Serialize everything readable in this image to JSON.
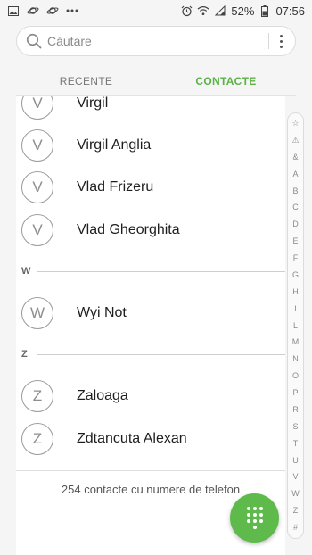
{
  "status_bar": {
    "battery": "52%",
    "time": "07:56",
    "left_icons": [
      "gallery-icon",
      "saturn-icon",
      "saturn-icon",
      "more-dots-icon"
    ],
    "right_icons": [
      "alarm-icon",
      "wifi-icon",
      "signal-icon",
      "battery-icon"
    ]
  },
  "search": {
    "placeholder": "Căutare",
    "icon": "search-icon",
    "menu_icon": "more-vertical-icon"
  },
  "tabs": [
    {
      "label": "RECENTE",
      "active": false
    },
    {
      "label": "CONTACTE",
      "active": true
    }
  ],
  "colors": {
    "accent": "#5cb247",
    "fab": "#5fba4c"
  },
  "contacts": {
    "groups": [
      {
        "letter": "",
        "items": [
          {
            "initial": "V",
            "name": "Virgil"
          },
          {
            "initial": "V",
            "name": "Virgil Anglia"
          },
          {
            "initial": "V",
            "name": "Vlad Frizeru"
          },
          {
            "initial": "V",
            "name": "Vlad Gheorghita"
          }
        ]
      },
      {
        "letter": "W",
        "items": [
          {
            "initial": "W",
            "name": "Wyi Not"
          }
        ]
      },
      {
        "letter": "Z",
        "items": [
          {
            "initial": "Z",
            "name": "Zaloaga"
          },
          {
            "initial": "Z",
            "name": "Zdtancuta Alexan"
          }
        ]
      }
    ],
    "count_text": "254 contacte cu numere de telefon"
  },
  "index": [
    "☆",
    "⚠",
    "&",
    "A",
    "B",
    "C",
    "D",
    "E",
    "F",
    "G",
    "H",
    "I",
    "L",
    "M",
    "N",
    "O",
    "P",
    "R",
    "S",
    "T",
    "U",
    "V",
    "W",
    "Z",
    "#"
  ],
  "fab": {
    "icon": "dialpad-icon"
  }
}
